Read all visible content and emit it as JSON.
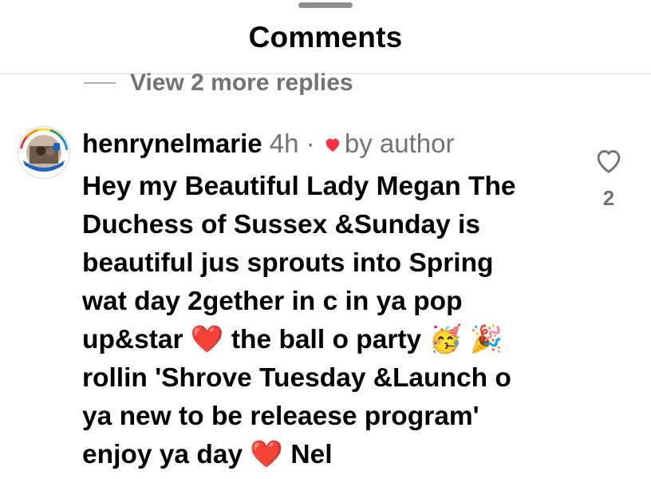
{
  "header": {
    "title": "Comments"
  },
  "replies": {
    "view_more_label": "View 2 more replies"
  },
  "comment": {
    "username": "henrynelmarie",
    "time": "4h",
    "separator": "·",
    "badge_icon": "heart-icon",
    "badge_label": "by author",
    "badge_color": "#ff3040",
    "text": "Hey my Beautiful Lady Megan The\nDuchess of Sussex &Sunday is\nbeautiful jus sprouts into Spring\nwat day 2gether in c in ya pop\nup&star ❤️ the ball o party 🥳 🎉\nrollin 'Shrove Tuesday &Launch o\nya new to be releaese program'\nenjoy ya day ❤️ Nel",
    "like_icon": "heart-outline-icon",
    "like_count": "2"
  }
}
